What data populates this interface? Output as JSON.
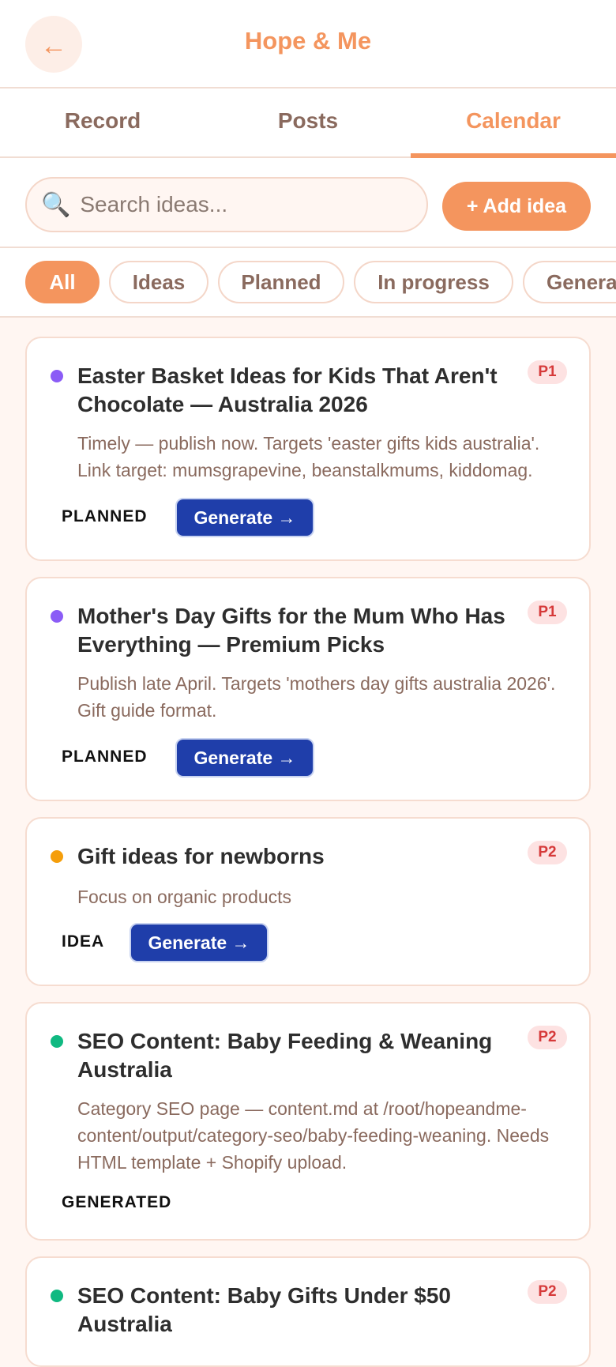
{
  "header": {
    "back_icon": "left-arrow-icon",
    "back_glyph": "←",
    "title": "Hope & Me"
  },
  "tabs": [
    {
      "label": "Record",
      "active": false
    },
    {
      "label": "Posts",
      "active": false
    },
    {
      "label": "Calendar",
      "active": true
    }
  ],
  "search": {
    "icon": "search-icon",
    "icon_glyph": "🔍",
    "placeholder": "Search ideas...",
    "value": "",
    "add_label": "+ Add idea"
  },
  "filters": [
    {
      "label": "All",
      "active": true
    },
    {
      "label": "Ideas",
      "active": false
    },
    {
      "label": "Planned",
      "active": false
    },
    {
      "label": "In progress",
      "active": false
    },
    {
      "label": "Generated",
      "active": false
    }
  ],
  "ideas": [
    {
      "title": "Easter Basket Ideas for Kids That Aren't Chocolate — Australia 2026",
      "description": "Timely — publish now. Targets 'easter gifts kids australia'. Link target: mumsgrapevine, beanstalkmums, kiddomag.",
      "priority": "P1",
      "status": "PLANNED",
      "dot_color": "#8b5cf6",
      "generate_label": "Generate →"
    },
    {
      "title": "Mother's Day Gifts for the Mum Who Has Everything — Premium Picks",
      "description": "Publish late April. Targets 'mothers day gifts australia 2026'. Gift guide format.",
      "priority": "P1",
      "status": "PLANNED",
      "dot_color": "#8b5cf6",
      "generate_label": "Generate →"
    },
    {
      "title": "Gift ideas for newborns",
      "description": "Focus on organic products",
      "priority": "P2",
      "status": "IDEA",
      "dot_color": "#f59e0b",
      "generate_label": "Generate →"
    },
    {
      "title": "SEO Content: Baby Feeding & Weaning Australia",
      "description": "Category SEO page — content.md at /root/hopeandme-content/output/category-seo/baby-feeding-weaning. Needs HTML template + Shopify upload.",
      "priority": "P2",
      "status": "GENERATED",
      "dot_color": "#10b981"
    },
    {
      "title": "SEO Content: Baby Gifts Under $50 Australia",
      "priority": "P2",
      "dot_color": "#10b981"
    }
  ],
  "colors": {
    "accent": "#f4955e",
    "primary_button": "#1f3eaa",
    "priority_badge_bg": "#fde2e2",
    "priority_badge_text": "#d63a3a",
    "background": "#fff6f2"
  }
}
